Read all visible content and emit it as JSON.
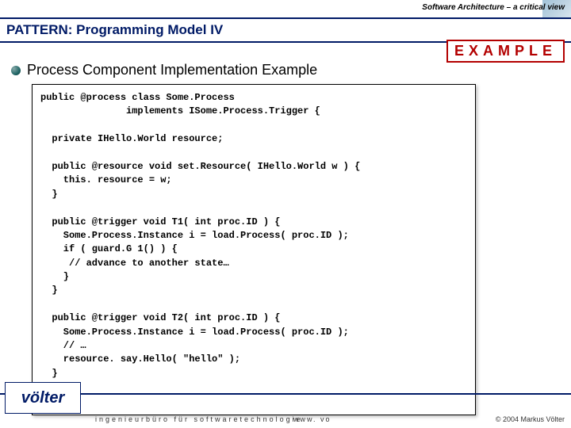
{
  "header": {
    "top": "Software Architecture – a critical view",
    "title": "PATTERN: Programming Model IV",
    "badge": "EXAMPLE"
  },
  "bullet": "Process Component Implementation Example",
  "code": "public @process class Some.Process\n               implements ISome.Process.Trigger {\n\n  private IHello.World resource;\n\n  public @resource void set.Resource( IHello.World w ) {\n    this. resource = w;\n  }\n\n  public @trigger void T1( int proc.ID ) {\n    Some.Process.Instance i = load.Process( proc.ID );\n    if ( guard.G 1() ) {\n     // advance to another state…\n    }\n  }\n\n  public @trigger void T2( int proc.ID ) {\n    Some.Process.Instance i = load.Process( proc.ID );\n    // …\n    resource. say.Hello( \"hello\" );\n  }\n\n}",
  "footer": {
    "logo": "völter",
    "left": "ingenieurbüro für softwaretechnologie",
    "mid": "www. vo",
    "right": "© 2004 Markus Völter"
  }
}
